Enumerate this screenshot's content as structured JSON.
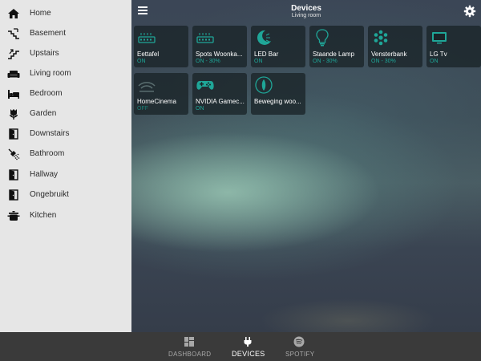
{
  "sidebar": {
    "items": [
      {
        "label": "Home",
        "icon": "home-icon"
      },
      {
        "label": "Basement",
        "icon": "stairs-down-icon"
      },
      {
        "label": "Upstairs",
        "icon": "stairs-up-icon"
      },
      {
        "label": "Living room",
        "icon": "sofa-icon"
      },
      {
        "label": "Bedroom",
        "icon": "bed-icon"
      },
      {
        "label": "Garden",
        "icon": "flower-icon"
      },
      {
        "label": "Downstairs",
        "icon": "door-icon"
      },
      {
        "label": "Bathroom",
        "icon": "shower-icon"
      },
      {
        "label": "Hallway",
        "icon": "door-icon"
      },
      {
        "label": "Ongebruikt",
        "icon": "door-icon"
      },
      {
        "label": "Kitchen",
        "icon": "pot-icon"
      }
    ]
  },
  "header": {
    "title": "Devices",
    "subtitle": "Living room",
    "menu_icon": "hamburger-menu-icon",
    "settings_icon": "gear-icon"
  },
  "devices": [
    {
      "name": "Eettafel",
      "state": "ON",
      "icon": "led-strip-icon"
    },
    {
      "name": "Spots Woonka...",
      "state": "ON - 30%",
      "icon": "led-strip-icon"
    },
    {
      "name": "LED Bar",
      "state": "ON",
      "icon": "moon-light-icon"
    },
    {
      "name": "Staande Lamp",
      "state": "ON - 30%",
      "icon": "bulb-icon"
    },
    {
      "name": "Vensterbank",
      "state": "ON - 30%",
      "icon": "hue-dots-icon"
    },
    {
      "name": "LG Tv",
      "state": "ON",
      "icon": "tv-icon"
    },
    {
      "name": "HomeCinema",
      "state": "OFF",
      "icon": "wifi-icon"
    },
    {
      "name": "NVIDIA Gamec...",
      "state": "ON",
      "icon": "gamepad-icon"
    },
    {
      "name": "Beweging woo...",
      "state": "",
      "icon": "motion-sensor-icon"
    }
  ],
  "tabs": [
    {
      "label": "DASHBOARD",
      "icon": "dashboard-icon",
      "active": false
    },
    {
      "label": "DEVICES",
      "icon": "plug-icon",
      "active": true
    },
    {
      "label": "SPOTIFY",
      "icon": "spotify-icon",
      "active": false
    }
  ],
  "colors": {
    "accent": "#1fa698",
    "sidebar_bg": "#e6e6e6",
    "tabbar_bg": "#3a3a3a"
  }
}
